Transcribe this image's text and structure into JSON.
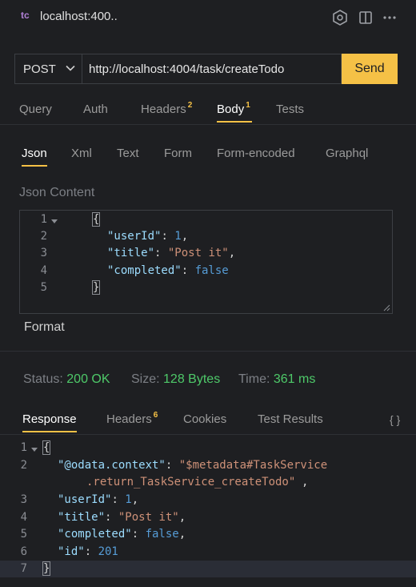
{
  "titlebar": {
    "logo": "tc",
    "title": "localhost:400..",
    "icons": [
      "sparkle-hex-icon",
      "split-editor-icon",
      "more-icon"
    ]
  },
  "request": {
    "method": "POST",
    "url": "http://localhost:4004/task/createTodo",
    "send_label": "Send"
  },
  "request_tabs": [
    {
      "label": "Query"
    },
    {
      "label": "Auth"
    },
    {
      "label": "Headers",
      "badge": "2"
    },
    {
      "label": "Body",
      "badge": "1",
      "active": true
    },
    {
      "label": "Tests"
    }
  ],
  "body_tabs": [
    {
      "label": "Json",
      "active": true
    },
    {
      "label": "Xml"
    },
    {
      "label": "Text"
    },
    {
      "label": "Form"
    },
    {
      "label": "Form-encoded"
    },
    {
      "label": "Graphql"
    }
  ],
  "json_content": {
    "label": "Json Content",
    "lines": [
      "1",
      "2",
      "3",
      "4",
      "5"
    ],
    "keys": {
      "userId": "\"userId\"",
      "title": "\"title\"",
      "completed": "\"completed\""
    },
    "values": {
      "userId": "1",
      "title": "\"Post it\"",
      "completed": "false"
    },
    "open_brace": "{",
    "close_brace": "}",
    "format_label": "Format"
  },
  "status": {
    "status_label": "Status:",
    "status_value": "200 OK",
    "size_label": "Size:",
    "size_value": "128 Bytes",
    "time_label": "Time:",
    "time_value": "361 ms"
  },
  "response_tabs": [
    {
      "label": "Response",
      "active": true
    },
    {
      "label": "Headers",
      "badge": "6"
    },
    {
      "label": "Cookies"
    },
    {
      "label": "Test Results"
    }
  ],
  "response_braces_icon": "{ }",
  "response": {
    "lines": [
      "1",
      "2",
      "3",
      "4",
      "5",
      "6",
      "7"
    ],
    "open_brace": "{",
    "close_brace": "}",
    "context_key": "\"@odata.context\"",
    "context_value_1": "\"$metadata#TaskService",
    "context_value_2": ".return_TaskService_createTodo\"",
    "userId_key": "\"userId\"",
    "userId_value": "1",
    "title_key": "\"title\"",
    "title_value": "\"Post it\"",
    "completed_key": "\"completed\"",
    "completed_value": "false",
    "id_key": "\"id\"",
    "id_value": "201"
  },
  "colors": {
    "accent": "#f5c146",
    "status_ok": "#4ec969",
    "background": "#1e1f22"
  }
}
